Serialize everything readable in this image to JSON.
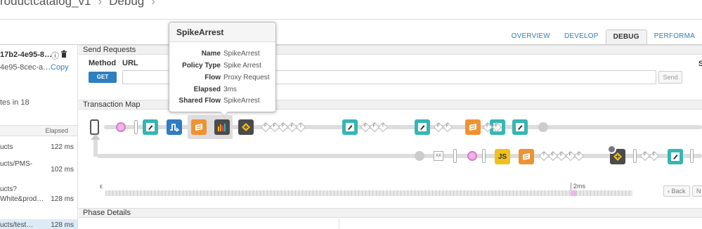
{
  "breadcrumb": {
    "part1": "roductcatalog_v1",
    "part2": "Debug",
    "part3": ""
  },
  "tabs": [
    "OVERVIEW",
    "DEVELOP",
    "DEBUG",
    "PERFORMA"
  ],
  "left": {
    "session_title": "17b2-4e95-8…",
    "session_id": "4e95-8cec-a…",
    "copy_label": "Copy",
    "minutes_text": "tes in 18",
    "elapsed_header": "Elapsed",
    "rows": [
      {
        "name": "ucts",
        "name2": "",
        "ms": "122 ms"
      },
      {
        "name": "ucts/PMS-",
        "name2": "",
        "ms": "102 ms"
      },
      {
        "name": "ucts?",
        "name2": "White&prod…",
        "ms": "128 ms"
      },
      {
        "name": "ucts/test…",
        "name2": "",
        "ms": "128 ms"
      }
    ]
  },
  "send_requests": {
    "section_title": "Send Requests",
    "method_label": "Method",
    "url_label": "URL",
    "method_value": "GET",
    "url_value": "",
    "send_label": "Send",
    "right_letter": "S"
  },
  "transaction_map": {
    "section_title": "Transaction Map",
    "flags_top": [
      "F",
      "F",
      "F",
      "F",
      "T",
      "F",
      "F",
      "T",
      "F",
      "F",
      "F",
      "F"
    ],
    "flags_bottom": [
      "T",
      "F",
      "F",
      "F",
      "F",
      "F",
      "F"
    ],
    "ax_label": "AX",
    "js_label": "JS",
    "timeline_left": "ε",
    "timeline_right": "2ms",
    "back_label": "Back",
    "next_label": "N"
  },
  "phase_details": {
    "section_title": "Phase Details"
  },
  "tooltip": {
    "title": "SpikeArrest",
    "rows": [
      {
        "k": "Name",
        "v": "SpikeArrest"
      },
      {
        "k": "Policy Type",
        "v": "Spike Arrest"
      },
      {
        "k": "Flow",
        "v": "Proxy Request"
      },
      {
        "k": "Elapsed",
        "v": "3ms"
      },
      {
        "k": "Shared Flow",
        "v": "SpikeArrest"
      }
    ]
  },
  "colors": {
    "teal": "#35b6b4",
    "blue": "#2c7cc6",
    "orange": "#ef9234",
    "dark": "#4b4b4b",
    "yellow": "#f2c01d",
    "link": "#2d7fbf"
  }
}
